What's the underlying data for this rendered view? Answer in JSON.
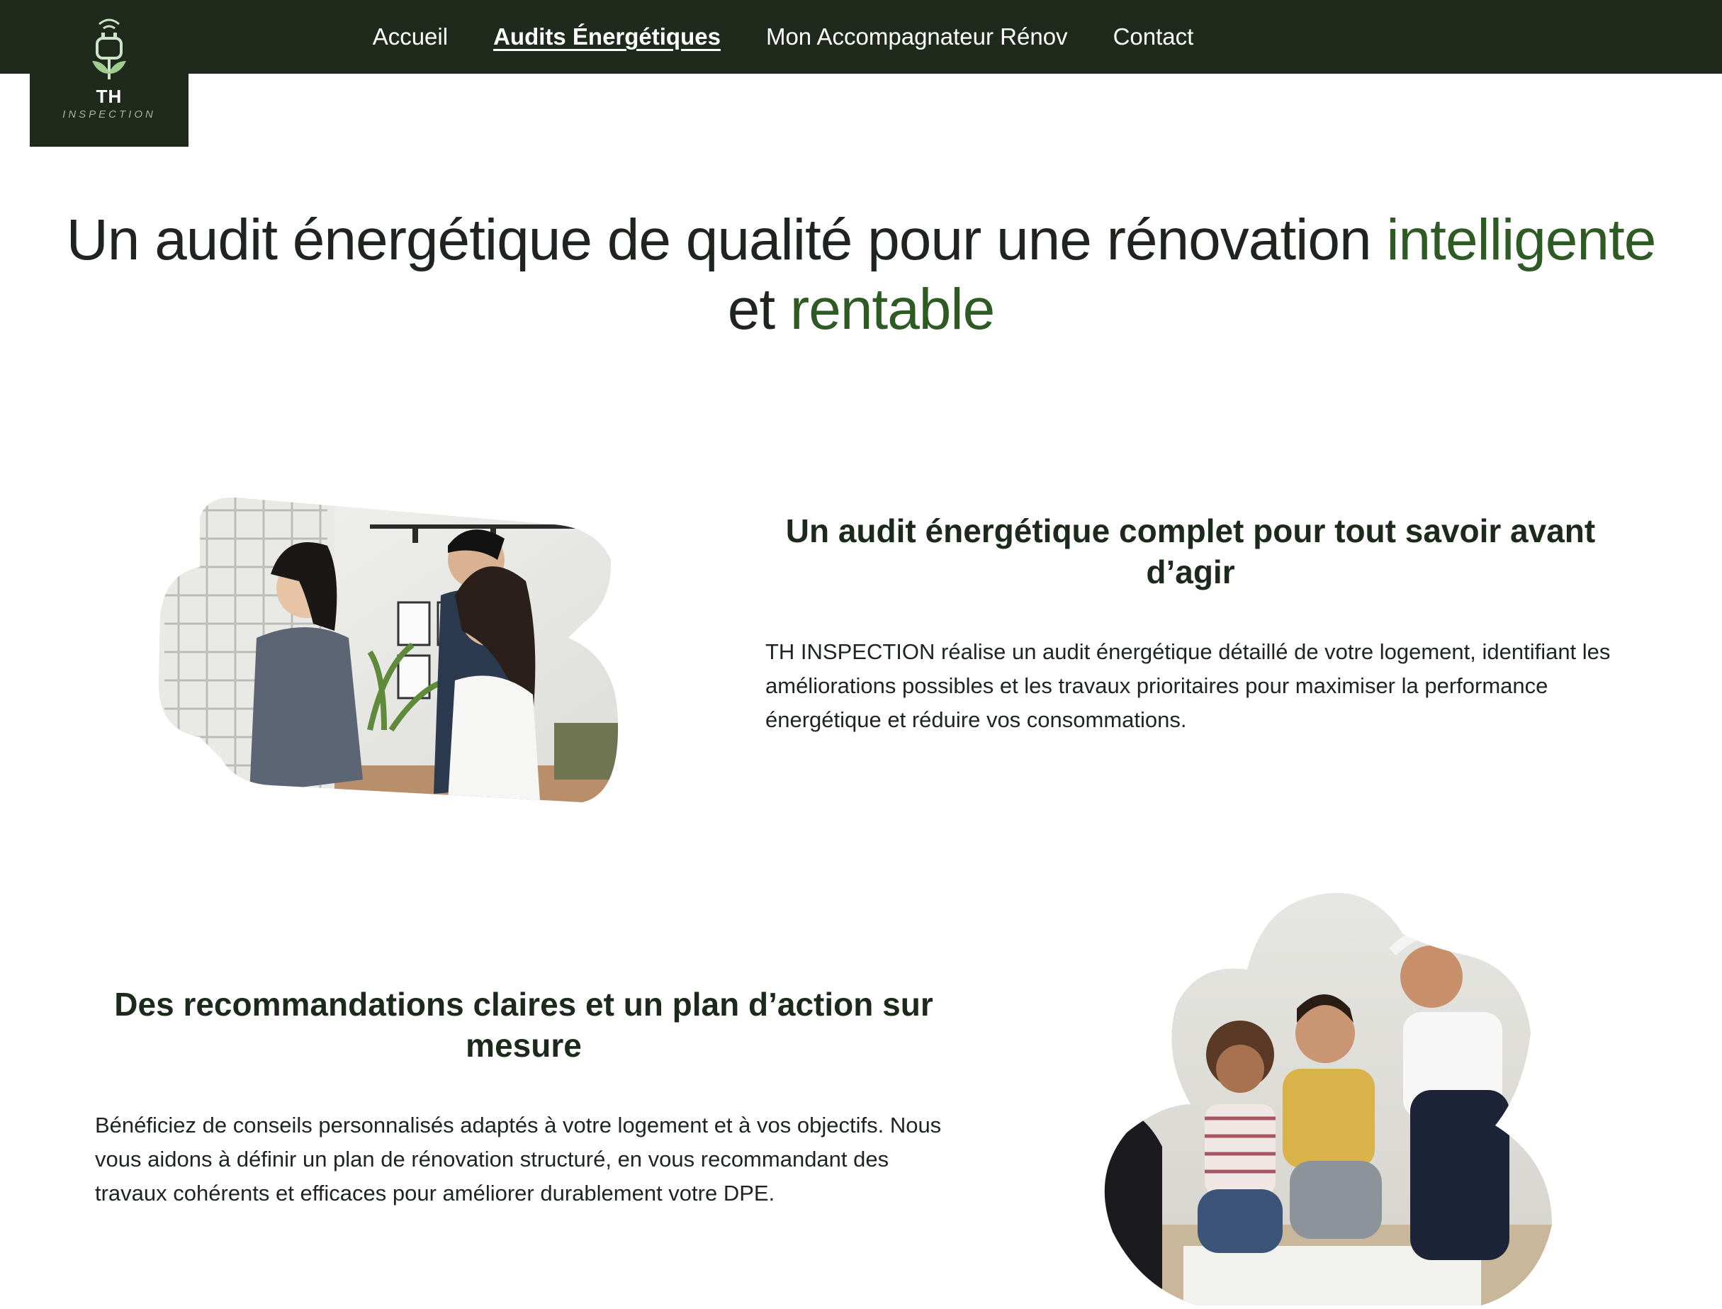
{
  "logo": {
    "icon": "plug-leaf-icon",
    "line1": "TH",
    "line2": "INSPECTION"
  },
  "nav": {
    "items": [
      {
        "label": "Accueil",
        "active": false
      },
      {
        "label": "Audits Énergétiques",
        "active": true
      },
      {
        "label": "Mon Accompagnateur Rénov",
        "active": false
      },
      {
        "label": "Contact",
        "active": false
      }
    ]
  },
  "hero": {
    "part1": "Un audit énergétique de qualité pour une rénovation ",
    "highlight1": "intelligente",
    "part2": " et ",
    "highlight2": "rentable"
  },
  "section1": {
    "title": "Un audit énergétique complet pour tout savoir avant d’agir",
    "text": "TH INSPECTION réalise un audit énergétique détaillé de votre logement, identifiant les améliorations possibles et les travaux prioritaires pour maximiser la performance énergétique et réduire vos consommations."
  },
  "section2": {
    "title": "Des recommandations claires et un plan d’action sur mesure",
    "text": "Bénéficiez de conseils personnalisés adaptés à votre logement et à vos objectifs. Nous vous aidons à définir un plan de rénovation structuré, en vous recommandant des travaux cohérents et efficaces pour améliorer durablement votre DPE."
  },
  "colors": {
    "nav_bg": "#1f2a1d",
    "accent_green": "#2e5a23",
    "heading_dark": "#1c2a1b"
  }
}
